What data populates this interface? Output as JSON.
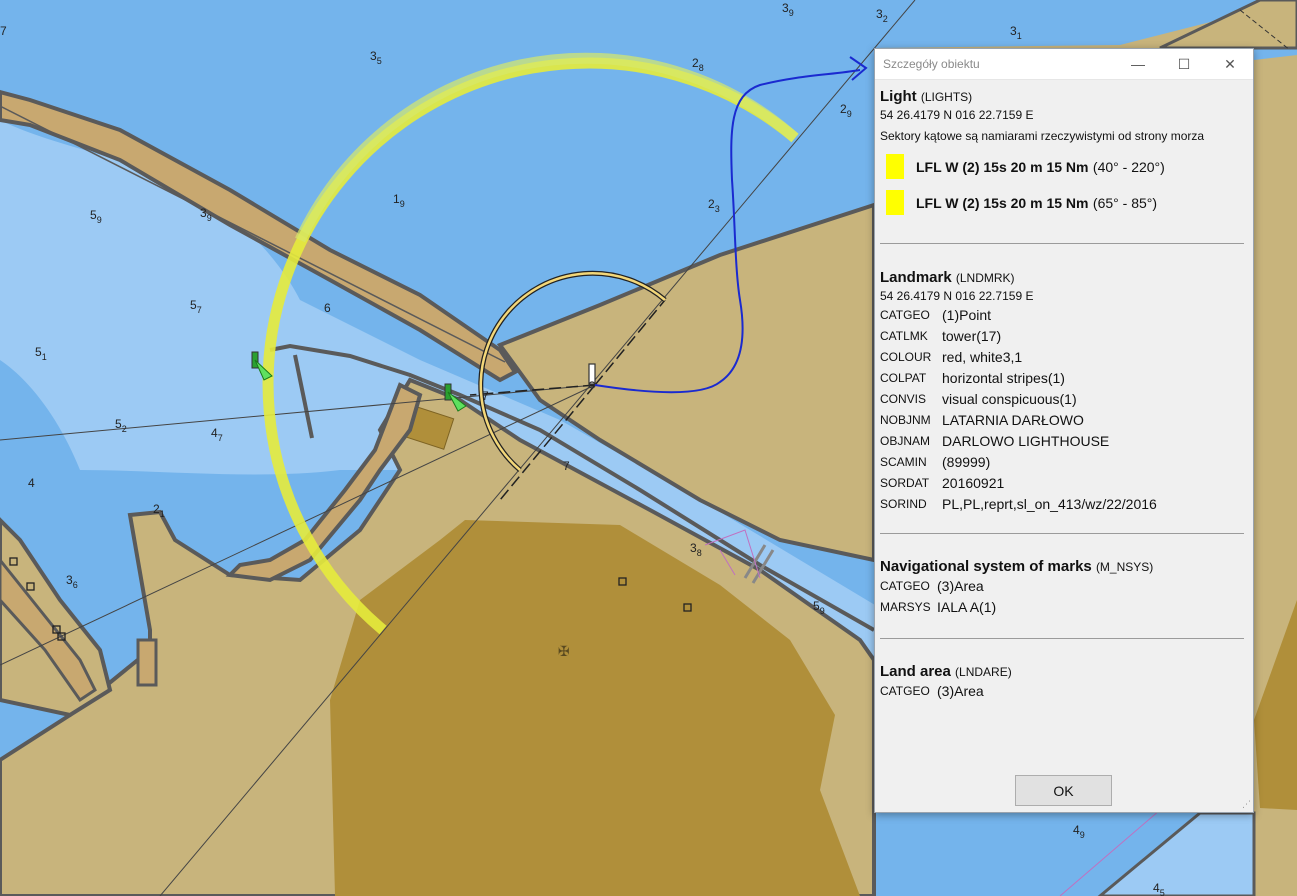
{
  "chart": {
    "soundings": [
      {
        "main": "3",
        "sub": "9"
      },
      {
        "main": "3",
        "sub": "2"
      },
      {
        "main": "3",
        "sub": "1"
      },
      {
        "main": "3",
        "sub": "5"
      },
      {
        "main": "2",
        "sub": "8"
      },
      {
        "main": "2",
        "sub": "9"
      },
      {
        "main": "1",
        "sub": "9"
      },
      {
        "main": "2",
        "sub": "3"
      },
      {
        "main": "5",
        "sub": "9"
      },
      {
        "main": "3",
        "sub": "9"
      },
      {
        "main": "5",
        "sub": "7"
      },
      {
        "main": "6",
        "sub": ""
      },
      {
        "main": "5",
        "sub": "1"
      },
      {
        "main": "5",
        "sub": "2"
      },
      {
        "main": "4",
        "sub": "7"
      },
      {
        "main": "4",
        "sub": ""
      },
      {
        "main": "2",
        "sub": "1"
      },
      {
        "main": "3",
        "sub": "6"
      },
      {
        "main": "7",
        "sub": ""
      },
      {
        "main": "7",
        "sub": ""
      },
      {
        "main": "3",
        "sub": "8"
      },
      {
        "main": "5",
        "sub": "9"
      },
      {
        "main": "4",
        "sub": "9"
      },
      {
        "main": "4",
        "sub": "5"
      },
      {
        "main": "7",
        "sub": ""
      }
    ]
  },
  "dialog": {
    "title": "Szczegóły obiektu",
    "ok_label": "OK",
    "light": {
      "name": "Light",
      "code": "(LIGHTS)",
      "coords": "54 26.4179 N 016 22.7159 E",
      "note": "Sektory kątowe są namiarami rzeczywistymi od strony morza",
      "sectors": [
        {
          "desc": "LFL W (2) 15s 20 m 15 Nm",
          "range": "(40° - 220°)",
          "color": "#ffff00"
        },
        {
          "desc": "LFL W (2) 15s 20 m 15 Nm",
          "range": "(65° - 85°)",
          "color": "#ffff00"
        }
      ]
    },
    "landmark": {
      "name": "Landmark",
      "code": "(LNDMRK)",
      "coords": "54 26.4179 N 016 22.7159 E",
      "attrs": [
        {
          "key": "CATGEO",
          "val": "(1)Point"
        },
        {
          "key": "CATLMK",
          "val": "tower(17)"
        },
        {
          "key": "COLOUR",
          "val": "red, white3,1"
        },
        {
          "key": "COLPAT",
          "val": "horizontal stripes(1)"
        },
        {
          "key": "CONVIS",
          "val": "visual conspicuous(1)"
        },
        {
          "key": "NOBJNM",
          "val": "LATARNIA DARŁOWO"
        },
        {
          "key": "OBJNAM",
          "val": "DARLOWO LIGHTHOUSE"
        },
        {
          "key": "SCAMIN",
          "val": "(89999)"
        },
        {
          "key": "SORDAT",
          "val": "20160921"
        },
        {
          "key": "SORIND",
          "val": "PL,PL,reprt,sl_on_413/wz/22/2016"
        }
      ]
    },
    "navsys": {
      "name": "Navigational system of marks",
      "code": "(M_NSYS)",
      "attrs": [
        {
          "key": "CATGEO",
          "val": "(3)Area"
        },
        {
          "key": "MARSYS",
          "val": "IALA A(1)"
        }
      ]
    },
    "landarea": {
      "name": "Land area",
      "code": "(LNDARE)",
      "attrs": [
        {
          "key": "CATGEO",
          "val": "(3)Area"
        }
      ]
    }
  },
  "colors": {
    "sea_deep": "#74b4ec",
    "sea_shallow": "#9ccaf4",
    "land": "#c8b47c",
    "built_up": "#b08f3a",
    "coastline": "#5a5a5a",
    "sector_arc": "#e6eb3c",
    "track": "#1a2ad0",
    "swatch": "#ffff00"
  }
}
